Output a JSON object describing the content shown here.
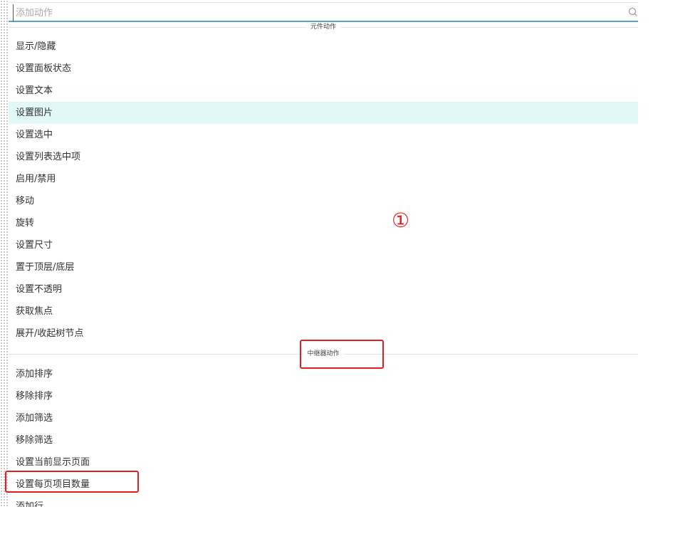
{
  "search": {
    "placeholder": "添加动作"
  },
  "sections": {
    "widget_actions": "元件动作",
    "repeater_actions": "中继器动作"
  },
  "widget_action_items": [
    "显示/隐藏",
    "设置面板状态",
    "设置文本",
    "设置图片",
    "设置选中",
    "设置列表选中项",
    "启用/禁用",
    "移动",
    "旋转",
    "设置尺寸",
    "置于顶层/底层",
    "设置不透明",
    "获取焦点",
    "展开/收起树节点"
  ],
  "repeater_action_items": [
    "添加排序",
    "移除排序",
    "添加筛选",
    "移除筛选",
    "设置当前显示页面",
    "设置每页项目数量",
    "添加行"
  ],
  "highlighted_item": "设置图片",
  "annotation": {
    "number": "①"
  },
  "colors": {
    "accent": "#5aa3cc",
    "highlight": "#e1f8f7",
    "annotation": "#e02020"
  }
}
